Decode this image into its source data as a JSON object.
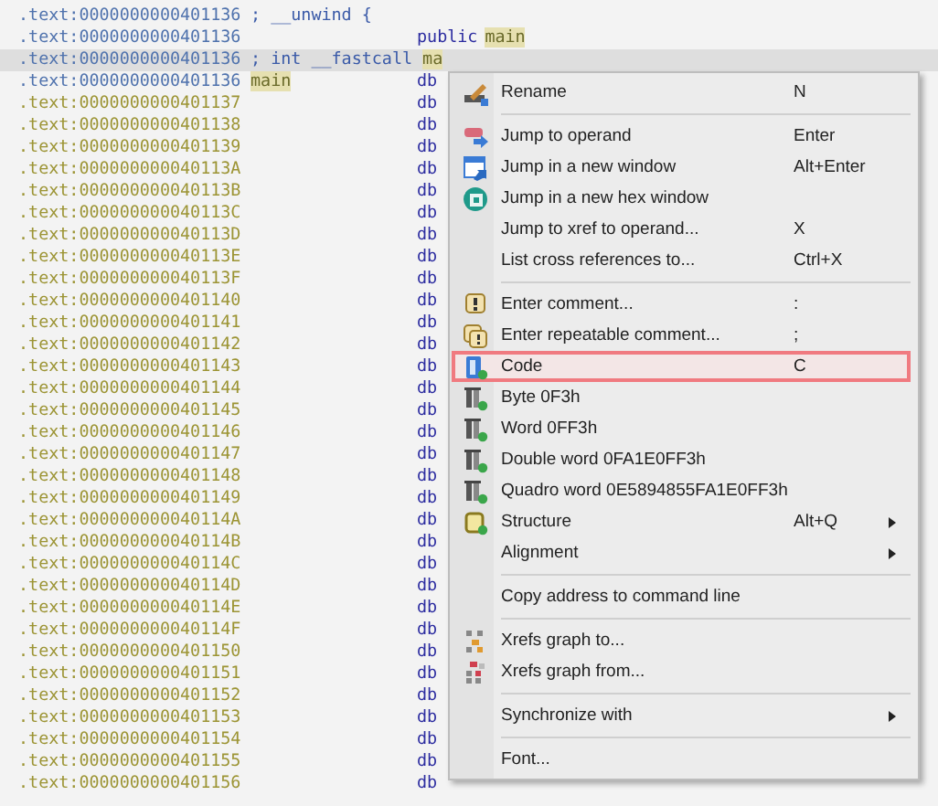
{
  "listing": {
    "rows": [
      {
        "address": ".text:0000000000401136",
        "kind": "code",
        "selected": false,
        "comment": [
          {
            "text": "; __unwind {",
            "highlighted": false
          }
        ]
      },
      {
        "address": ".text:0000000000401136",
        "kind": "code",
        "selected": false,
        "mnemonic": "public",
        "operand": "main",
        "operand_highlighted": true
      },
      {
        "address": ".text:0000000000401136",
        "kind": "code",
        "selected": true,
        "comment": [
          {
            "text": "; int __fastcall ",
            "highlighted": false
          },
          {
            "text": "ma",
            "highlighted": true
          }
        ]
      },
      {
        "address": ".text:0000000000401136",
        "kind": "code",
        "selected": false,
        "label": "main",
        "label_highlighted": true,
        "mnemonic": "db"
      },
      {
        "address": ".text:0000000000401137",
        "kind": "data",
        "selected": false,
        "mnemonic": "db"
      },
      {
        "address": ".text:0000000000401138",
        "kind": "data",
        "selected": false,
        "mnemonic": "db"
      },
      {
        "address": ".text:0000000000401139",
        "kind": "data",
        "selected": false,
        "mnemonic": "db"
      },
      {
        "address": ".text:000000000040113A",
        "kind": "data",
        "selected": false,
        "mnemonic": "db"
      },
      {
        "address": ".text:000000000040113B",
        "kind": "data",
        "selected": false,
        "mnemonic": "db"
      },
      {
        "address": ".text:000000000040113C",
        "kind": "data",
        "selected": false,
        "mnemonic": "db"
      },
      {
        "address": ".text:000000000040113D",
        "kind": "data",
        "selected": false,
        "mnemonic": "db"
      },
      {
        "address": ".text:000000000040113E",
        "kind": "data",
        "selected": false,
        "mnemonic": "db"
      },
      {
        "address": ".text:000000000040113F",
        "kind": "data",
        "selected": false,
        "mnemonic": "db"
      },
      {
        "address": ".text:0000000000401140",
        "kind": "data",
        "selected": false,
        "mnemonic": "db"
      },
      {
        "address": ".text:0000000000401141",
        "kind": "data",
        "selected": false,
        "mnemonic": "db"
      },
      {
        "address": ".text:0000000000401142",
        "kind": "data",
        "selected": false,
        "mnemonic": "db"
      },
      {
        "address": ".text:0000000000401143",
        "kind": "data",
        "selected": false,
        "mnemonic": "db"
      },
      {
        "address": ".text:0000000000401144",
        "kind": "data",
        "selected": false,
        "mnemonic": "db"
      },
      {
        "address": ".text:0000000000401145",
        "kind": "data",
        "selected": false,
        "mnemonic": "db"
      },
      {
        "address": ".text:0000000000401146",
        "kind": "data",
        "selected": false,
        "mnemonic": "db"
      },
      {
        "address": ".text:0000000000401147",
        "kind": "data",
        "selected": false,
        "mnemonic": "db"
      },
      {
        "address": ".text:0000000000401148",
        "kind": "data",
        "selected": false,
        "mnemonic": "db"
      },
      {
        "address": ".text:0000000000401149",
        "kind": "data",
        "selected": false,
        "mnemonic": "db"
      },
      {
        "address": ".text:000000000040114A",
        "kind": "data",
        "selected": false,
        "mnemonic": "db"
      },
      {
        "address": ".text:000000000040114B",
        "kind": "data",
        "selected": false,
        "mnemonic": "db"
      },
      {
        "address": ".text:000000000040114C",
        "kind": "data",
        "selected": false,
        "mnemonic": "db"
      },
      {
        "address": ".text:000000000040114D",
        "kind": "data",
        "selected": false,
        "mnemonic": "db"
      },
      {
        "address": ".text:000000000040114E",
        "kind": "data",
        "selected": false,
        "mnemonic": "db"
      },
      {
        "address": ".text:000000000040114F",
        "kind": "data",
        "selected": false,
        "mnemonic": "db"
      },
      {
        "address": ".text:0000000000401150",
        "kind": "data",
        "selected": false,
        "mnemonic": "db"
      },
      {
        "address": ".text:0000000000401151",
        "kind": "data",
        "selected": false,
        "mnemonic": "db"
      },
      {
        "address": ".text:0000000000401152",
        "kind": "data",
        "selected": false,
        "mnemonic": "db"
      },
      {
        "address": ".text:0000000000401153",
        "kind": "data",
        "selected": false,
        "mnemonic": "db"
      },
      {
        "address": ".text:0000000000401154",
        "kind": "data",
        "selected": false,
        "mnemonic": "db"
      },
      {
        "address": ".text:0000000000401155",
        "kind": "data",
        "selected": false,
        "mnemonic": "db"
      },
      {
        "address": ".text:0000000000401156",
        "kind": "data",
        "selected": false,
        "mnemonic": "db"
      }
    ]
  },
  "context_menu": {
    "items": [
      {
        "kind": "rename",
        "label": "Rename",
        "shortcut": "N",
        "selected": false
      },
      {
        "kind": "separator"
      },
      {
        "kind": "operand",
        "label": "Jump to operand",
        "shortcut": "Enter",
        "selected": false
      },
      {
        "kind": "window",
        "label": "Jump in a new window",
        "shortcut": "Alt+Enter",
        "selected": false
      },
      {
        "kind": "hex",
        "label": "Jump in a new hex window",
        "selected": false
      },
      {
        "kind": "plain",
        "label": "Jump to xref to operand...",
        "shortcut": "X",
        "selected": false
      },
      {
        "kind": "plain",
        "label": "List cross references to...",
        "shortcut": "Ctrl+X",
        "selected": false
      },
      {
        "kind": "separator"
      },
      {
        "kind": "comment",
        "label": "Enter comment...",
        "shortcut": ":",
        "selected": false
      },
      {
        "kind": "repeat",
        "label": "Enter repeatable comment...",
        "shortcut": ";",
        "selected": false
      },
      {
        "kind": "code",
        "label": "Code",
        "shortcut": "C",
        "selected": true
      },
      {
        "kind": "data",
        "label": "Byte 0F3h",
        "selected": false
      },
      {
        "kind": "data",
        "label": "Word 0FF3h",
        "selected": false
      },
      {
        "kind": "data",
        "label": "Double word 0FA1E0FF3h",
        "selected": false
      },
      {
        "kind": "data",
        "label": "Quadro word 0E5894855FA1E0FF3h",
        "selected": false
      },
      {
        "kind": "struct",
        "label": "Structure",
        "shortcut": "Alt+Q",
        "submenu": true,
        "selected": false
      },
      {
        "kind": "plain",
        "label": "Alignment",
        "submenu": true,
        "selected": false
      },
      {
        "kind": "separator"
      },
      {
        "kind": "plain",
        "label": "Copy address to command line",
        "selected": false
      },
      {
        "kind": "separator"
      },
      {
        "kind": "graphto",
        "label": "Xrefs graph to...",
        "selected": false
      },
      {
        "kind": "graphfrom",
        "label": "Xrefs graph from...",
        "selected": false
      },
      {
        "kind": "separator"
      },
      {
        "kind": "plain",
        "label": "Synchronize with",
        "submenu": true,
        "selected": false
      },
      {
        "kind": "separator"
      },
      {
        "kind": "plain",
        "label": "Font...",
        "selected": false
      }
    ]
  }
}
